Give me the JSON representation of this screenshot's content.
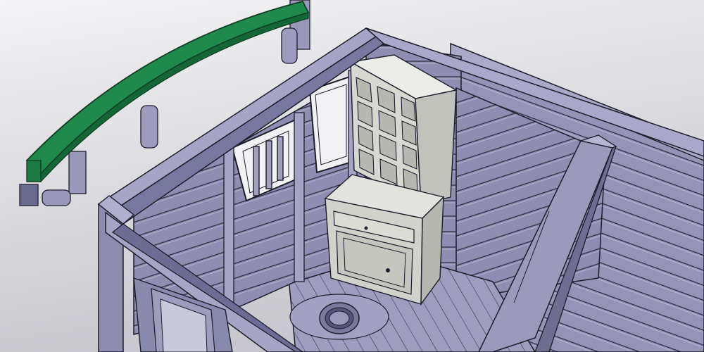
{
  "scene": {
    "kind": "cad-render",
    "subject": "caboose-interior-3d-model",
    "colors": {
      "background_top": "#f2f2f4",
      "background_bottom": "#c9c9cf",
      "body_light": "#a7a6c6",
      "body_mid": "#8584a8",
      "body_dark": "#5d5c80",
      "edge": "#1c1c2a",
      "rail_green": "#1f8a4c",
      "rail_green_dark": "#146636",
      "cabinet_light": "#e7e7e3",
      "cabinet_mid": "#cfcfca",
      "cabinet_dark": "#aeaea8",
      "window_glass": "#f2f2f4"
    }
  }
}
